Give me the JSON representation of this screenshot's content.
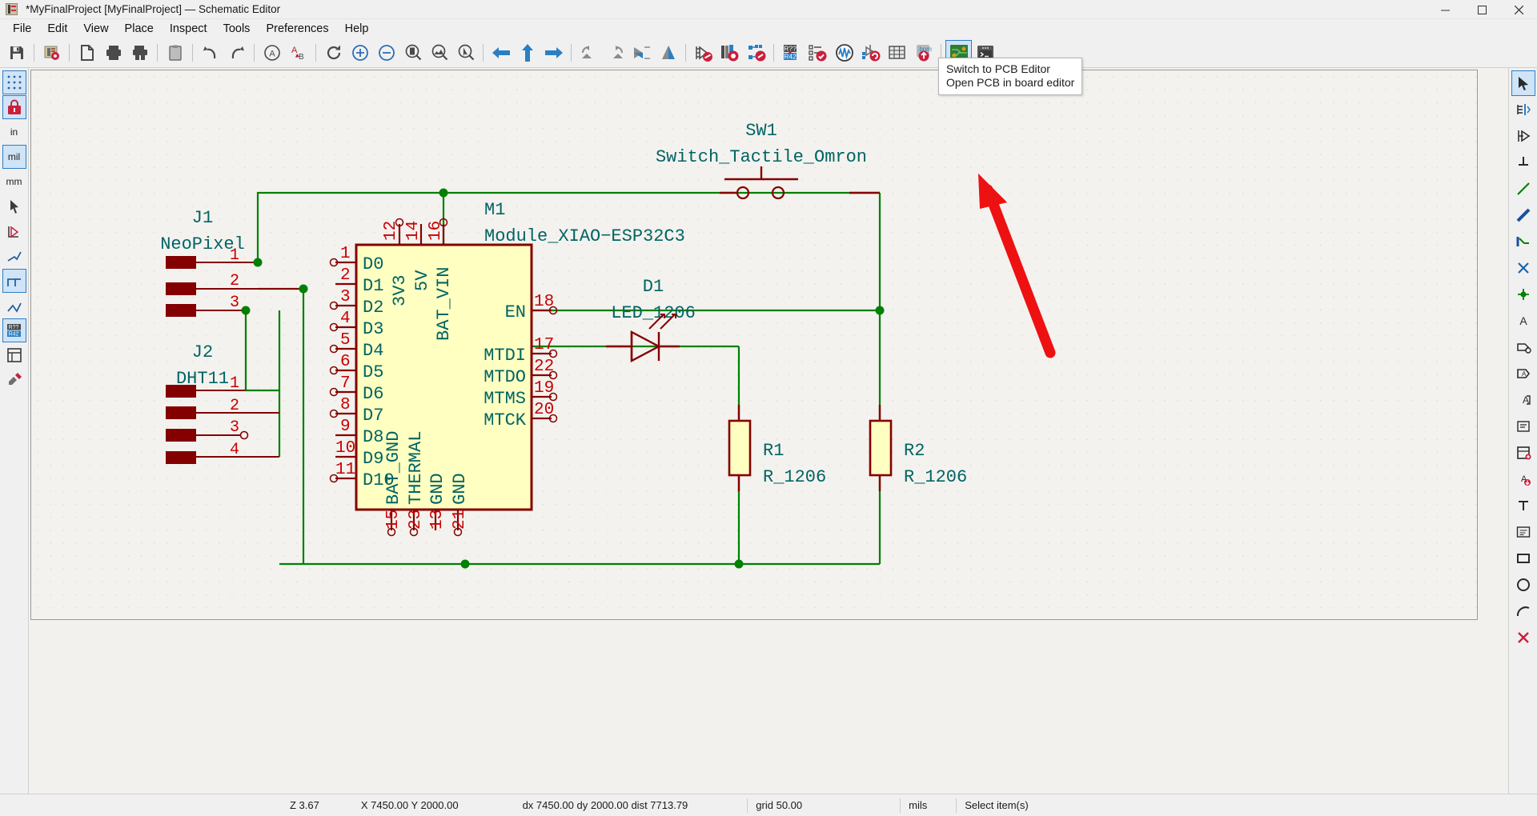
{
  "window": {
    "title": "*MyFinalProject [MyFinalProject] — Schematic Editor",
    "app_icon": "kicad-schematic-icon",
    "minimize": "minimize-button",
    "maximize": "maximize-button",
    "close": "close-button"
  },
  "menubar": {
    "items": [
      {
        "label": "File"
      },
      {
        "label": "Edit"
      },
      {
        "label": "View"
      },
      {
        "label": "Place"
      },
      {
        "label": "Inspect"
      },
      {
        "label": "Tools"
      },
      {
        "label": "Preferences"
      },
      {
        "label": "Help"
      }
    ]
  },
  "toolbar": {
    "buttons": [
      {
        "name": "save-icon",
        "tip": "Save"
      },
      {
        "name": "open-project-icon",
        "tip": "Open schematic setup"
      },
      {
        "name": "page-settings-icon",
        "tip": "Page settings"
      },
      {
        "name": "print-icon",
        "tip": "Print"
      },
      {
        "name": "plot-icon",
        "tip": "Plot"
      },
      {
        "name": "paste-icon",
        "tip": "Paste"
      },
      {
        "name": "undo-icon",
        "tip": "Undo"
      },
      {
        "name": "redo-icon",
        "tip": "Redo"
      },
      {
        "name": "find-icon",
        "tip": "Find"
      },
      {
        "name": "find-replace-icon",
        "tip": "Find and replace"
      },
      {
        "name": "refresh-icon",
        "tip": "Refresh"
      },
      {
        "name": "zoom-in-icon",
        "tip": "Zoom in"
      },
      {
        "name": "zoom-out-icon",
        "tip": "Zoom out"
      },
      {
        "name": "zoom-fit-page-icon",
        "tip": "Zoom to fit page"
      },
      {
        "name": "zoom-fit-objects-icon",
        "tip": "Zoom to fit objects"
      },
      {
        "name": "zoom-area-icon",
        "tip": "Zoom to selection"
      },
      {
        "name": "navigate-back-icon",
        "tip": "Leave sheet"
      },
      {
        "name": "navigate-up-icon",
        "tip": "Go up"
      },
      {
        "name": "navigate-forward-icon",
        "tip": "Enter sheet"
      },
      {
        "name": "rotate-ccw-icon",
        "tip": "Rotate counterclockwise"
      },
      {
        "name": "rotate-cw-icon",
        "tip": "Rotate clockwise"
      },
      {
        "name": "mirror-horizontal-icon",
        "tip": "Mirror horizontally"
      },
      {
        "name": "mirror-vertical-icon",
        "tip": "Mirror vertically"
      },
      {
        "name": "symbol-properties-icon",
        "tip": "Edit symbol properties"
      },
      {
        "name": "symbol-library-icon",
        "tip": "Symbol library browser"
      },
      {
        "name": "footprint-assign-icon",
        "tip": "Assign footprints"
      },
      {
        "name": "annotate-icon",
        "tip": "Annotate schematic"
      },
      {
        "name": "erc-icon",
        "tip": "Electrical rules checker"
      },
      {
        "name": "simulator-icon",
        "tip": "Simulator"
      },
      {
        "name": "update-pcb-icon",
        "tip": "Update PCB from schematic"
      },
      {
        "name": "bom-table-icon",
        "tip": "Generate bill of materials"
      },
      {
        "name": "export-netlist-icon",
        "tip": "Export netlist"
      },
      {
        "name": "switch-to-pcb-editor-icon",
        "tip": "Switch to PCB Editor"
      },
      {
        "name": "scripting-console-icon",
        "tip": "Scripting console"
      }
    ]
  },
  "tooltip": {
    "title": "Switch to PCB Editor",
    "subtitle": "Open PCB in board editor"
  },
  "left_toolbar": {
    "items": [
      {
        "name": "toggle-grid-icon",
        "label": ""
      },
      {
        "name": "grid-override-icon",
        "label": ""
      },
      {
        "name": "units-inches-button",
        "label": "in"
      },
      {
        "name": "units-mils-button",
        "label": "mil"
      },
      {
        "name": "units-mm-button",
        "label": "mm"
      },
      {
        "name": "cursor-full-window-icon",
        "label": ""
      },
      {
        "name": "hidden-pins-icon",
        "label": ""
      },
      {
        "name": "line-mode-free-icon",
        "label": ""
      },
      {
        "name": "line-mode-90-icon",
        "label": ""
      },
      {
        "name": "line-mode-45-icon",
        "label": ""
      },
      {
        "name": "annotate-auto-icon",
        "label": ""
      },
      {
        "name": "hierarchy-navigator-icon",
        "label": ""
      },
      {
        "name": "properties-manager-icon",
        "label": ""
      }
    ]
  },
  "right_toolbar": {
    "items": [
      {
        "name": "select-tool-icon"
      },
      {
        "name": "highlight-net-tool-icon"
      },
      {
        "name": "place-symbol-tool-icon"
      },
      {
        "name": "place-power-tool-icon"
      },
      {
        "name": "draw-wire-tool-icon"
      },
      {
        "name": "draw-bus-tool-icon"
      },
      {
        "name": "wire-to-bus-entry-tool-icon"
      },
      {
        "name": "no-connect-tool-icon"
      },
      {
        "name": "junction-tool-icon"
      },
      {
        "name": "net-label-tool-icon"
      },
      {
        "name": "global-label-tool-icon"
      },
      {
        "name": "hierarchical-label-tool-icon"
      },
      {
        "name": "sheet-pin-tool-icon"
      },
      {
        "name": "text-box-tool-icon"
      },
      {
        "name": "place-sheet-tool-icon"
      },
      {
        "name": "import-sheet-pin-tool-icon"
      },
      {
        "name": "draw-text-tool-icon"
      },
      {
        "name": "draw-textbox-tool-icon"
      },
      {
        "name": "draw-rectangle-tool-icon"
      },
      {
        "name": "draw-circle-tool-icon"
      },
      {
        "name": "draw-arc-tool-icon"
      },
      {
        "name": "delete-tool-icon"
      }
    ]
  },
  "statusbar": {
    "zoom": "Z 3.67",
    "position": "X 7450.00  Y 2000.00",
    "delta": "dx 7450.00  dy 2000.00  dist 7713.79",
    "grid": "grid 50.00",
    "units": "mils",
    "mode": "Select item(s)"
  },
  "schematic": {
    "colors": {
      "component_outline": "#840000",
      "component_fill": "#ffffc2",
      "pin_name": "#006464",
      "pin_number": "#c80000",
      "wire": "#008000",
      "reference": "#006464",
      "background": "#f3f2ee"
    },
    "components": [
      {
        "ref": "J1",
        "value": "NeoPixel",
        "type": "connector",
        "pins": [
          "1",
          "2",
          "3"
        ]
      },
      {
        "ref": "J2",
        "value": "DHT11",
        "type": "connector",
        "pins": [
          "1",
          "2",
          "3",
          "4"
        ]
      },
      {
        "ref": "M1",
        "value": "Module_XIAO-ESP32C3",
        "type": "module",
        "left_pins": [
          {
            "num": "1",
            "name": "D0"
          },
          {
            "num": "2",
            "name": "D1"
          },
          {
            "num": "3",
            "name": "D2"
          },
          {
            "num": "4",
            "name": "D3"
          },
          {
            "num": "5",
            "name": "D4"
          },
          {
            "num": "6",
            "name": "D5"
          },
          {
            "num": "7",
            "name": "D6"
          },
          {
            "num": "8",
            "name": "D7"
          },
          {
            "num": "9",
            "name": "D8"
          },
          {
            "num": "10",
            "name": "D9"
          },
          {
            "num": "11",
            "name": "D10"
          }
        ],
        "top_pins": [
          {
            "num": "12",
            "name": "3V3"
          },
          {
            "num": "14",
            "name": "5V"
          },
          {
            "num": "16",
            "name": "BAT_VIN"
          }
        ],
        "right_pins": [
          {
            "num": "18",
            "name": "EN"
          },
          {
            "num": "17",
            "name": "MTDI"
          },
          {
            "num": "22",
            "name": "MTDO"
          },
          {
            "num": "19",
            "name": "MTMS"
          },
          {
            "num": "20",
            "name": "MTCK"
          }
        ],
        "bottom_pins": [
          {
            "num": "15",
            "name": "BAT_GND"
          },
          {
            "num": "23",
            "name": "THERMAL"
          },
          {
            "num": "13",
            "name": "GND"
          },
          {
            "num": "21",
            "name": "GND"
          }
        ]
      },
      {
        "ref": "SW1",
        "value": "Switch_Tactile_Omron",
        "type": "switch"
      },
      {
        "ref": "D1",
        "value": "LED_1206",
        "type": "led"
      },
      {
        "ref": "R1",
        "value": "R_1206",
        "type": "resistor"
      },
      {
        "ref": "R2",
        "value": "R_1206",
        "type": "resistor"
      }
    ]
  }
}
